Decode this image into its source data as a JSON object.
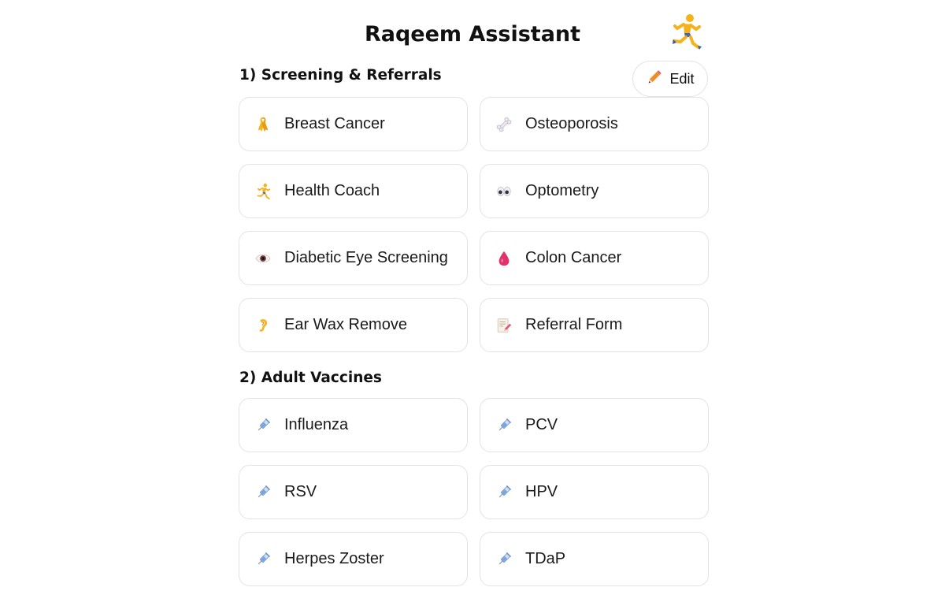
{
  "header": {
    "title": "Raqeem Assistant",
    "logo_icon": "running-person-icon"
  },
  "toolbar": {
    "edit_label": "Edit",
    "edit_icon": "pencil-icon"
  },
  "sections": [
    {
      "heading": "1) Screening & Referrals",
      "items": [
        {
          "label": "Breast Cancer",
          "icon": "ribbon-icon"
        },
        {
          "label": "Osteoporosis",
          "icon": "bone-icon"
        },
        {
          "label": "Health Coach",
          "icon": "running-person-icon"
        },
        {
          "label": "Optometry",
          "icon": "eyes-icon"
        },
        {
          "label": "Diabetic Eye Screening",
          "icon": "eye-icon"
        },
        {
          "label": "Colon Cancer",
          "icon": "blood-drop-icon"
        },
        {
          "label": "Ear Wax Remove",
          "icon": "ear-icon"
        },
        {
          "label": "Referral Form",
          "icon": "memo-icon"
        }
      ]
    },
    {
      "heading": "2) Adult Vaccines",
      "items": [
        {
          "label": "Influenza",
          "icon": "syringe-icon"
        },
        {
          "label": "PCV",
          "icon": "syringe-icon"
        },
        {
          "label": "RSV",
          "icon": "syringe-icon"
        },
        {
          "label": "HPV",
          "icon": "syringe-icon"
        },
        {
          "label": "Herpes Zoster",
          "icon": "syringe-icon"
        },
        {
          "label": "TDaP",
          "icon": "syringe-icon"
        }
      ]
    }
  ]
}
